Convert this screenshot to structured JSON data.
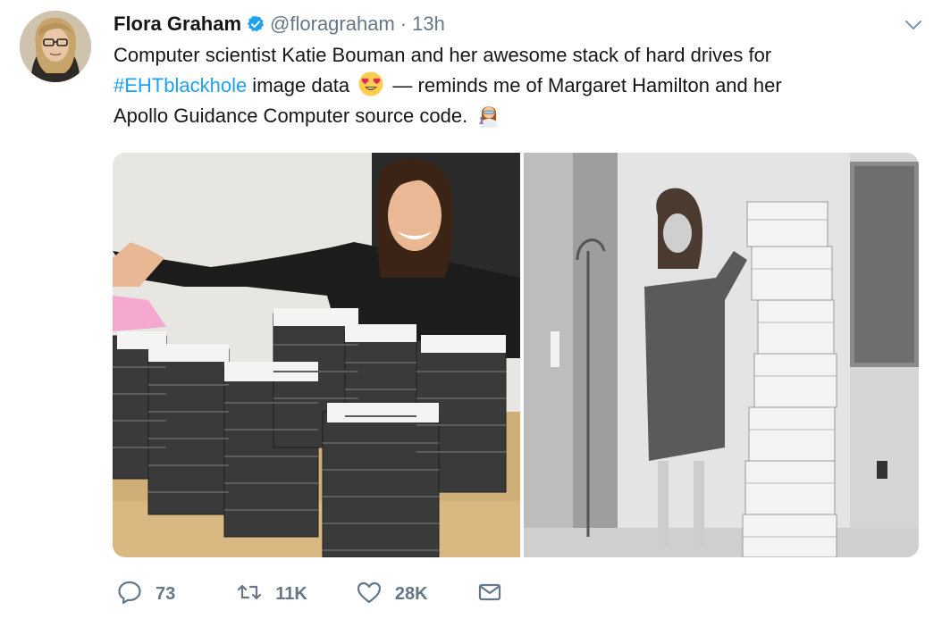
{
  "author": {
    "display_name": "Flora Graham",
    "handle": "@floragraham",
    "separator": "·",
    "time": "13h",
    "verified": true
  },
  "tweet": {
    "line1": "Computer scientist Katie Bouman and her awesome stack of hard drives for",
    "hashtag": "#EHTblackhole",
    "after_hashtag": " image data",
    "after_emoji": " — reminds me of Margaret Hamilton and her",
    "line3": "Apollo Guidance Computer source code.",
    "emoji_1": "smiling-face-with-heart-eyes",
    "emoji_2": "woman-scientist"
  },
  "media": [
    {
      "subject": "Katie Bouman with hard drive stacks"
    },
    {
      "subject": "Margaret Hamilton with Apollo source code listings"
    }
  ],
  "actions": {
    "replies": "73",
    "retweets": "11K",
    "likes": "28K"
  },
  "colors": {
    "link": "#1da1f2",
    "muted": "#657786",
    "verified": "#1da1f2"
  },
  "icons": [
    "reply-icon",
    "retweet-icon",
    "like-icon",
    "direct-message-icon",
    "chevron-down-icon",
    "verified-badge-icon"
  ]
}
